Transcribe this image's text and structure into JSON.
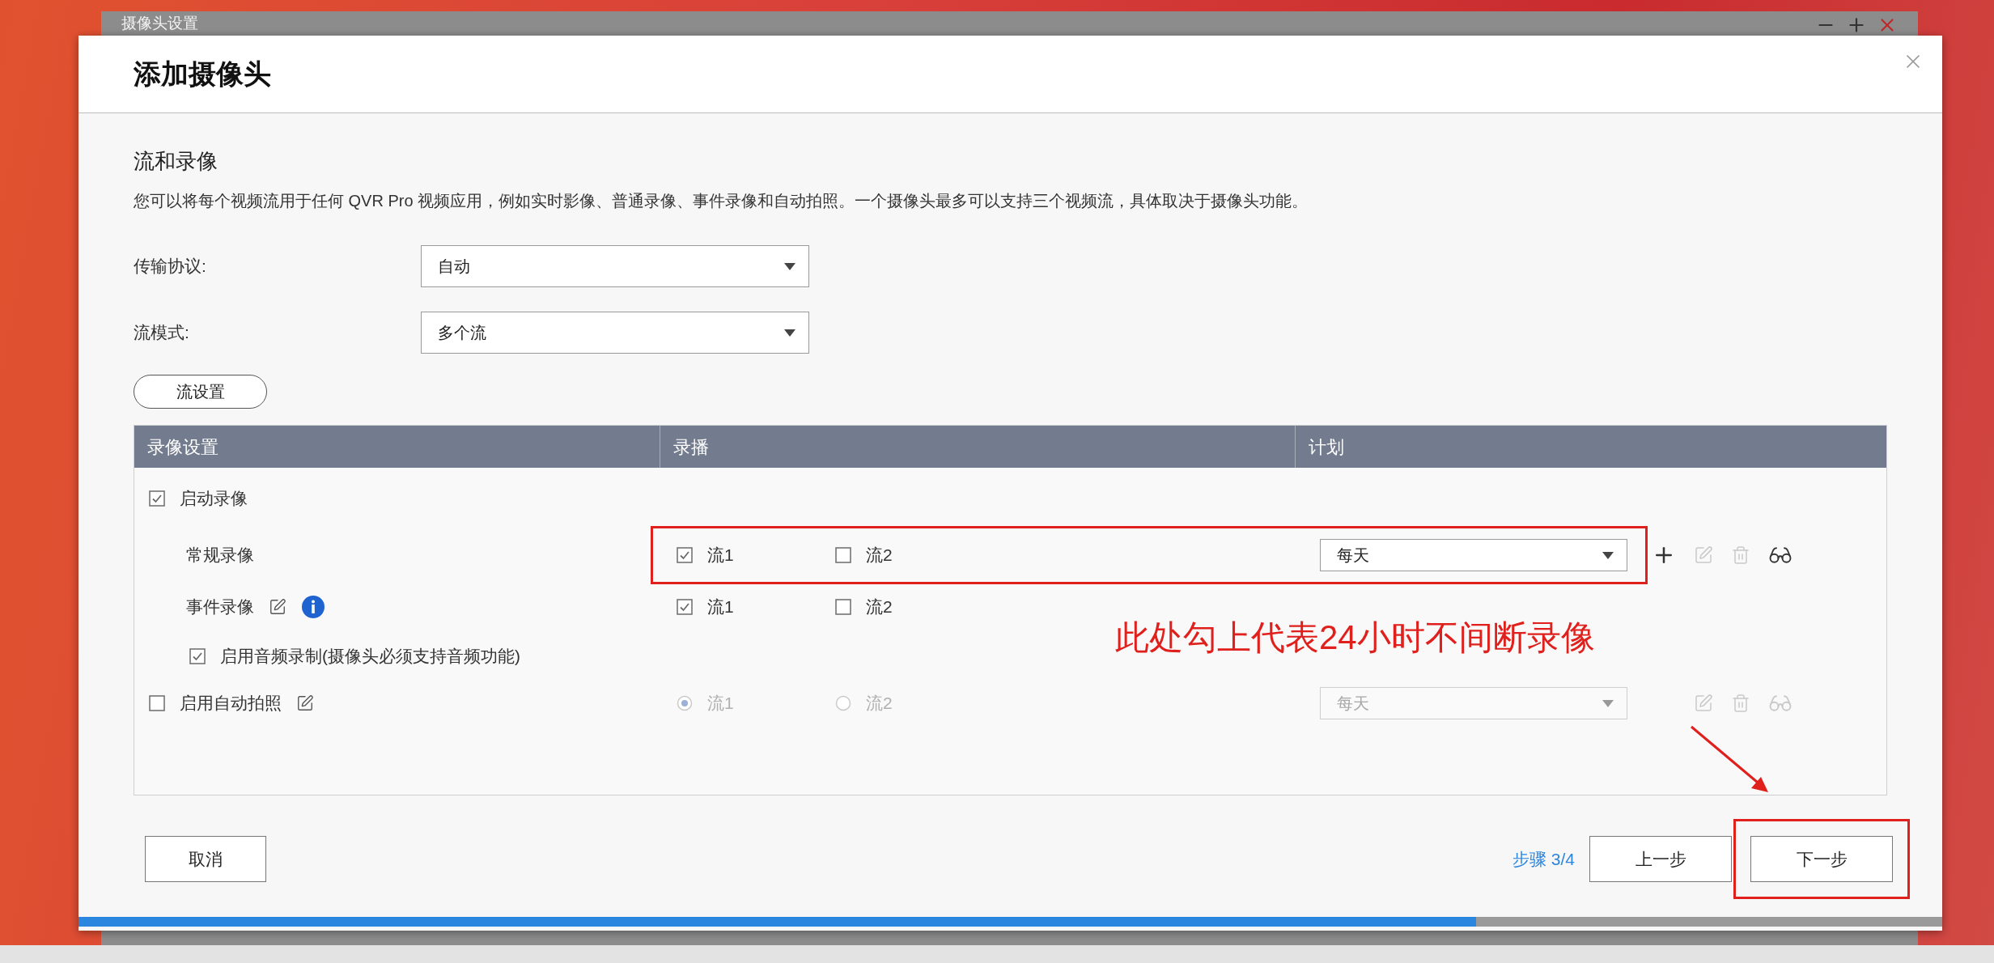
{
  "background_window": {
    "title": "摄像头设置"
  },
  "dialog": {
    "title": "添加摄像头",
    "section_title": "流和录像",
    "description": "您可以将每个视频流用于任何 QVR Pro 视频应用，例如实时影像、普通录像、事件录像和自动拍照。一个摄像头最多可以支持三个视频流，具体取决于摄像头功能。",
    "fields": [
      {
        "label": "传输协议:",
        "value": "自动"
      },
      {
        "label": "流模式:",
        "value": "多个流"
      }
    ],
    "stream_settings_button": "流设置",
    "table": {
      "columns": [
        "录像设置",
        "录播",
        "计划"
      ],
      "rows": [
        {
          "kind": "group",
          "label": "启动录像",
          "checked": true
        },
        {
          "kind": "recording",
          "label": "常规录像",
          "highlighted": true,
          "streams": [
            {
              "label": "流1",
              "checked": true
            },
            {
              "label": "流2",
              "checked": false
            }
          ],
          "schedule": "每天",
          "actions": [
            {
              "kind": "add",
              "disabled": false
            },
            {
              "kind": "edit",
              "disabled": true
            },
            {
              "kind": "delete",
              "disabled": true
            },
            {
              "kind": "view",
              "disabled": false
            }
          ]
        },
        {
          "kind": "recording",
          "label": "事件录像",
          "highlighted": false,
          "editable": true,
          "info": true,
          "streams": [
            {
              "label": "流1",
              "checked": true
            },
            {
              "label": "流2",
              "checked": false
            }
          ]
        },
        {
          "kind": "option",
          "label": "启用音频录制(摄像头必须支持音频功能)",
          "checked": true
        },
        {
          "kind": "snapshot",
          "label": "启用自动拍照",
          "checked": false,
          "disabled": true,
          "streams": [
            {
              "label": "流1",
              "selected": true
            },
            {
              "label": "流2",
              "selected": false
            }
          ],
          "schedule": "每天",
          "actions": [
            {
              "kind": "edit",
              "disabled": true
            },
            {
              "kind": "delete",
              "disabled": true
            },
            {
              "kind": "view",
              "disabled": true
            }
          ]
        }
      ]
    },
    "annotation": "此处勾上代表24小时不间断录像",
    "footer": {
      "cancel": "取消",
      "step": "步骤 3/4",
      "back": "上一步",
      "next": "下一步",
      "next_highlighted": true,
      "progress": {
        "level": 0.75
      }
    }
  }
}
